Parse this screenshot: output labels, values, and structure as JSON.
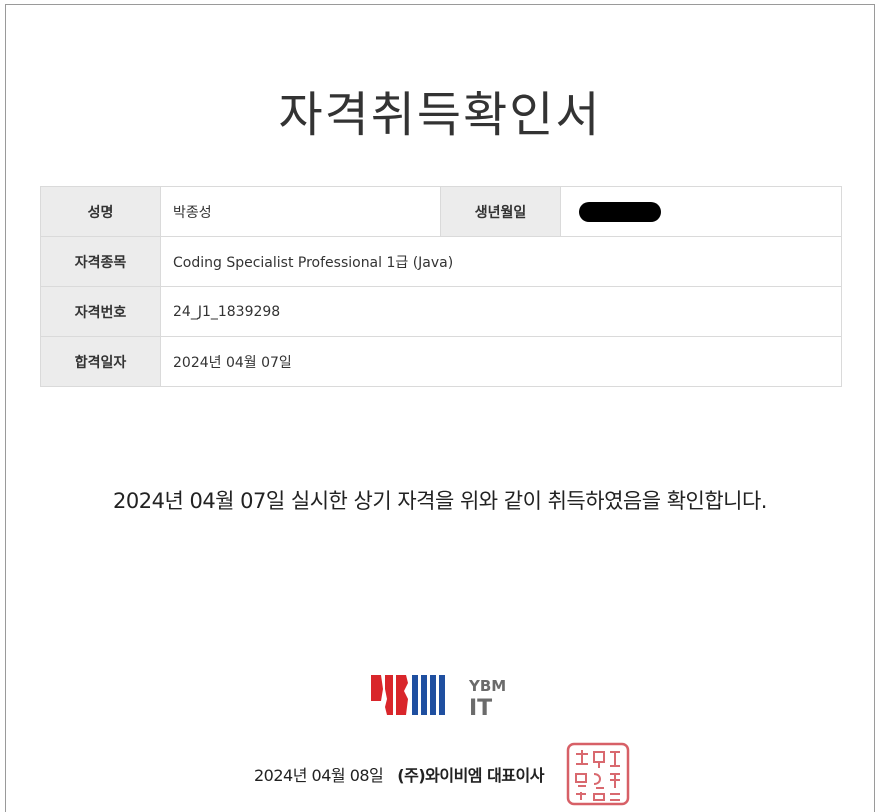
{
  "document": {
    "title": "자격취득확인서",
    "fields": {
      "name_label": "성명",
      "name_value": "박종성",
      "birth_label": "생년월일",
      "cert_label": "자격종목",
      "cert_value": "Coding Specialist Professional 1급 (Java)",
      "number_label": "자격번호",
      "number_value": "24_J1_1839298",
      "pass_label": "합격일자",
      "pass_value": "2024년 04월 07일"
    },
    "statement": "2024년 04월 07일 실시한 상기 자격을 위와 같이 취득하였음을 확인합니다.",
    "logo": {
      "line1": "YBM",
      "line2": "IT"
    },
    "issue_date": "2024년 04월 08일",
    "issuer": "(주)와이비엠 대표이사",
    "seal_text": "주와이비엠대표이사인"
  },
  "colors": {
    "logo_red": "#d9262b",
    "logo_blue": "#1f4fa0",
    "logo_gray": "#6b6b6b",
    "seal_red": "#d0444c"
  }
}
